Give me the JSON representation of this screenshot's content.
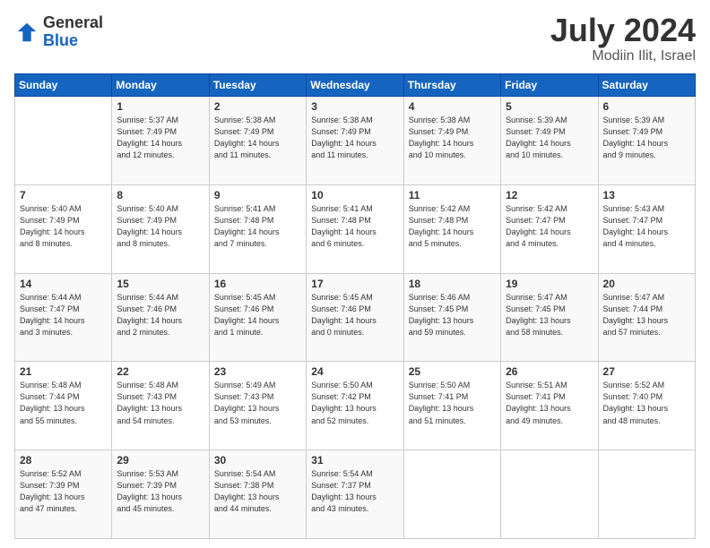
{
  "logo": {
    "general": "General",
    "blue": "Blue"
  },
  "header": {
    "month": "July 2024",
    "location": "Modiin Ilit, Israel"
  },
  "weekdays": [
    "Sunday",
    "Monday",
    "Tuesday",
    "Wednesday",
    "Thursday",
    "Friday",
    "Saturday"
  ],
  "weeks": [
    [
      {
        "day": "",
        "info": ""
      },
      {
        "day": "1",
        "info": "Sunrise: 5:37 AM\nSunset: 7:49 PM\nDaylight: 14 hours\nand 12 minutes."
      },
      {
        "day": "2",
        "info": "Sunrise: 5:38 AM\nSunset: 7:49 PM\nDaylight: 14 hours\nand 11 minutes."
      },
      {
        "day": "3",
        "info": "Sunrise: 5:38 AM\nSunset: 7:49 PM\nDaylight: 14 hours\nand 11 minutes."
      },
      {
        "day": "4",
        "info": "Sunrise: 5:38 AM\nSunset: 7:49 PM\nDaylight: 14 hours\nand 10 minutes."
      },
      {
        "day": "5",
        "info": "Sunrise: 5:39 AM\nSunset: 7:49 PM\nDaylight: 14 hours\nand 10 minutes."
      },
      {
        "day": "6",
        "info": "Sunrise: 5:39 AM\nSunset: 7:49 PM\nDaylight: 14 hours\nand 9 minutes."
      }
    ],
    [
      {
        "day": "7",
        "info": "Sunrise: 5:40 AM\nSunset: 7:49 PM\nDaylight: 14 hours\nand 8 minutes."
      },
      {
        "day": "8",
        "info": "Sunrise: 5:40 AM\nSunset: 7:49 PM\nDaylight: 14 hours\nand 8 minutes."
      },
      {
        "day": "9",
        "info": "Sunrise: 5:41 AM\nSunset: 7:48 PM\nDaylight: 14 hours\nand 7 minutes."
      },
      {
        "day": "10",
        "info": "Sunrise: 5:41 AM\nSunset: 7:48 PM\nDaylight: 14 hours\nand 6 minutes."
      },
      {
        "day": "11",
        "info": "Sunrise: 5:42 AM\nSunset: 7:48 PM\nDaylight: 14 hours\nand 5 minutes."
      },
      {
        "day": "12",
        "info": "Sunrise: 5:42 AM\nSunset: 7:47 PM\nDaylight: 14 hours\nand 4 minutes."
      },
      {
        "day": "13",
        "info": "Sunrise: 5:43 AM\nSunset: 7:47 PM\nDaylight: 14 hours\nand 4 minutes."
      }
    ],
    [
      {
        "day": "14",
        "info": "Sunrise: 5:44 AM\nSunset: 7:47 PM\nDaylight: 14 hours\nand 3 minutes."
      },
      {
        "day": "15",
        "info": "Sunrise: 5:44 AM\nSunset: 7:46 PM\nDaylight: 14 hours\nand 2 minutes."
      },
      {
        "day": "16",
        "info": "Sunrise: 5:45 AM\nSunset: 7:46 PM\nDaylight: 14 hours\nand 1 minute."
      },
      {
        "day": "17",
        "info": "Sunrise: 5:45 AM\nSunset: 7:46 PM\nDaylight: 14 hours\nand 0 minutes."
      },
      {
        "day": "18",
        "info": "Sunrise: 5:46 AM\nSunset: 7:45 PM\nDaylight: 13 hours\nand 59 minutes."
      },
      {
        "day": "19",
        "info": "Sunrise: 5:47 AM\nSunset: 7:45 PM\nDaylight: 13 hours\nand 58 minutes."
      },
      {
        "day": "20",
        "info": "Sunrise: 5:47 AM\nSunset: 7:44 PM\nDaylight: 13 hours\nand 57 minutes."
      }
    ],
    [
      {
        "day": "21",
        "info": "Sunrise: 5:48 AM\nSunset: 7:44 PM\nDaylight: 13 hours\nand 55 minutes."
      },
      {
        "day": "22",
        "info": "Sunrise: 5:48 AM\nSunset: 7:43 PM\nDaylight: 13 hours\nand 54 minutes."
      },
      {
        "day": "23",
        "info": "Sunrise: 5:49 AM\nSunset: 7:43 PM\nDaylight: 13 hours\nand 53 minutes."
      },
      {
        "day": "24",
        "info": "Sunrise: 5:50 AM\nSunset: 7:42 PM\nDaylight: 13 hours\nand 52 minutes."
      },
      {
        "day": "25",
        "info": "Sunrise: 5:50 AM\nSunset: 7:41 PM\nDaylight: 13 hours\nand 51 minutes."
      },
      {
        "day": "26",
        "info": "Sunrise: 5:51 AM\nSunset: 7:41 PM\nDaylight: 13 hours\nand 49 minutes."
      },
      {
        "day": "27",
        "info": "Sunrise: 5:52 AM\nSunset: 7:40 PM\nDaylight: 13 hours\nand 48 minutes."
      }
    ],
    [
      {
        "day": "28",
        "info": "Sunrise: 5:52 AM\nSunset: 7:39 PM\nDaylight: 13 hours\nand 47 minutes."
      },
      {
        "day": "29",
        "info": "Sunrise: 5:53 AM\nSunset: 7:39 PM\nDaylight: 13 hours\nand 45 minutes."
      },
      {
        "day": "30",
        "info": "Sunrise: 5:54 AM\nSunset: 7:38 PM\nDaylight: 13 hours\nand 44 minutes."
      },
      {
        "day": "31",
        "info": "Sunrise: 5:54 AM\nSunset: 7:37 PM\nDaylight: 13 hours\nand 43 minutes."
      },
      {
        "day": "",
        "info": ""
      },
      {
        "day": "",
        "info": ""
      },
      {
        "day": "",
        "info": ""
      }
    ]
  ]
}
